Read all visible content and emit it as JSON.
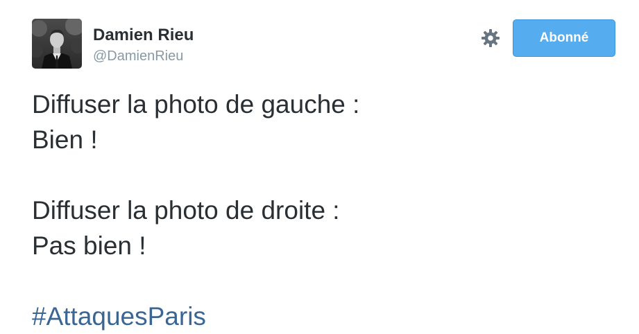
{
  "author": {
    "display_name": "Damien Rieu",
    "screen_name": "@DamienRieu",
    "avatar": "profile-photo"
  },
  "actions": {
    "settings_icon": "gear-icon",
    "follow_label": "Abonné",
    "follow_color": "#55acee"
  },
  "tweet": {
    "lines": [
      "Diffuser la photo de gauche :",
      "Bien !",
      "",
      "Diffuser la photo de droite :",
      "Pas bien !",
      ""
    ],
    "hashtag": "#AttaquesParis",
    "hashtag_color": "#3b6693"
  }
}
